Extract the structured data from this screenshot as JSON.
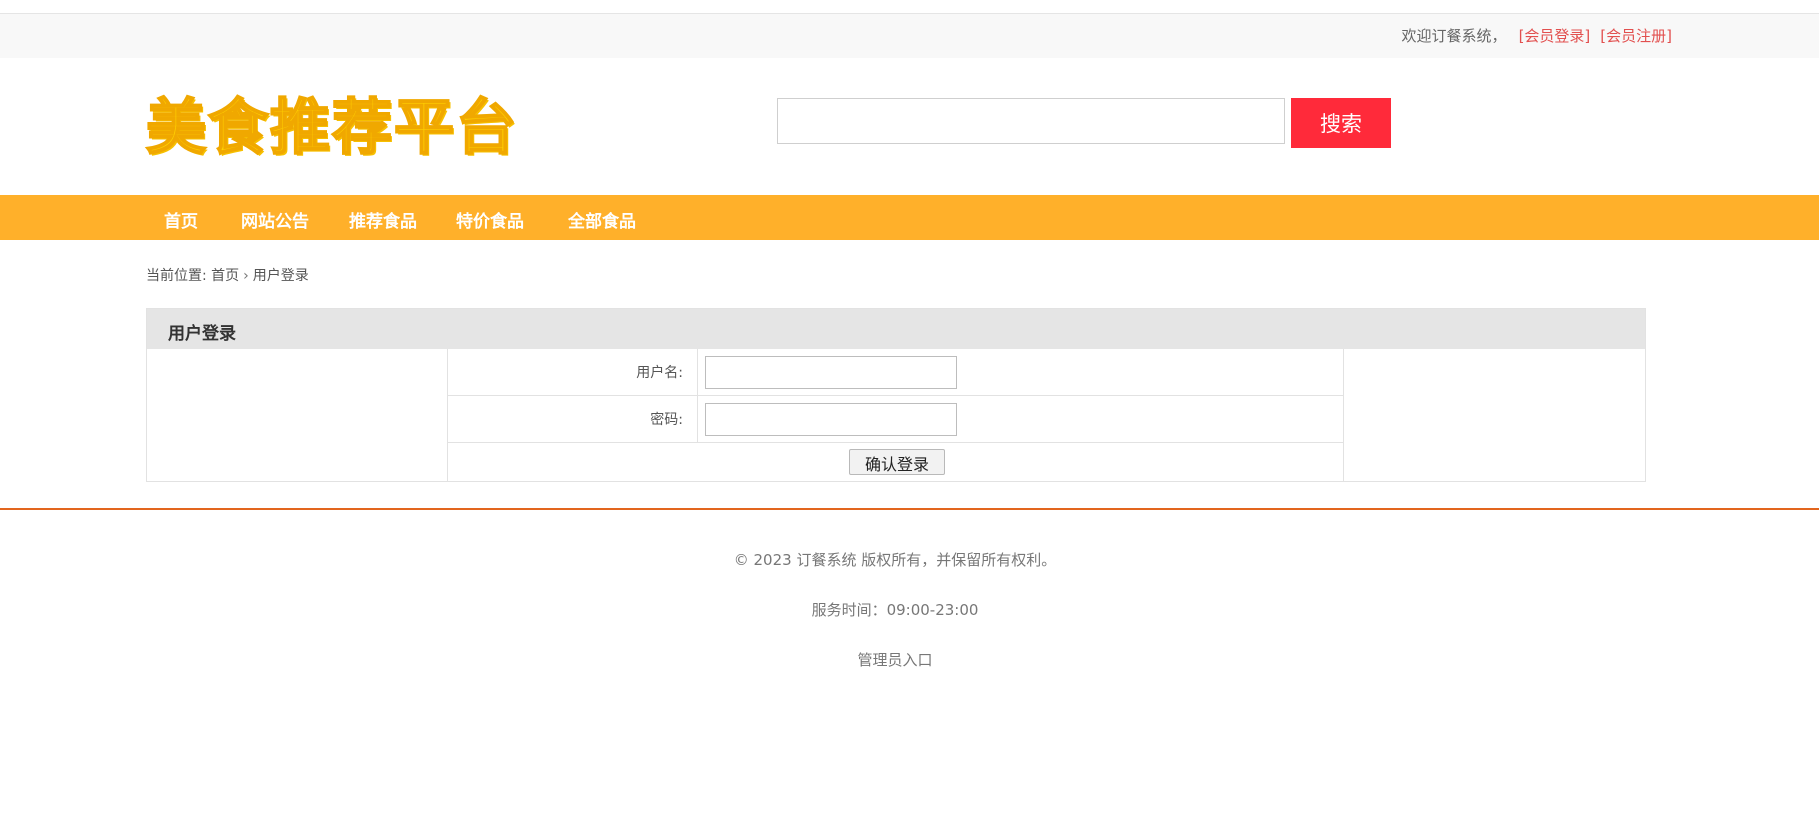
{
  "topbar": {
    "welcome": "欢迎订餐系统，",
    "login_link": "[会员登录]",
    "register_link": "[会员注册]"
  },
  "header": {
    "logo_text": "美食推荐平台",
    "search_placeholder": "",
    "search_button": "搜索"
  },
  "nav": {
    "items": [
      "首页",
      "网站公告",
      "推荐食品",
      "特价食品",
      "全部食品"
    ]
  },
  "breadcrumb": {
    "prefix": "当前位置:",
    "home": "首页",
    "current": "用户登录"
  },
  "login_panel": {
    "title": "用户登录",
    "username_label": "用户名:",
    "password_label": "密码:",
    "submit_label": "确认登录"
  },
  "footer": {
    "copyright": "© 2023 订餐系统 版权所有，并保留所有权利。",
    "service_hours": "服务时间：09:00-23:00",
    "admin_link": "管理员入口"
  },
  "colors": {
    "nav_bg": "#ffb02a",
    "search_button": "#ff2a3a",
    "link": "#e2504f",
    "divider": "#e2651e",
    "logo": "#ffd000"
  }
}
